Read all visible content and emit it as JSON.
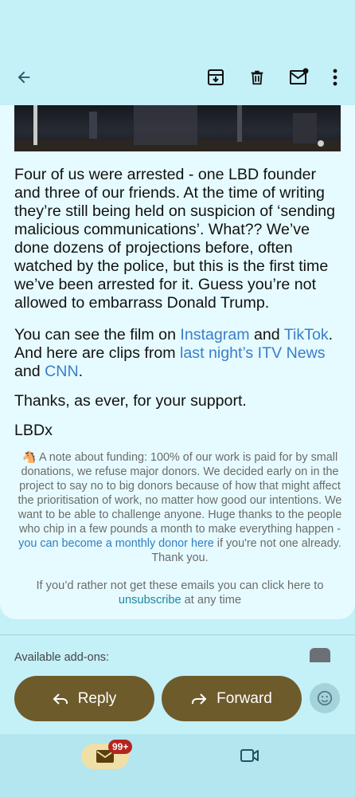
{
  "topbar": {
    "back_icon": "arrow-back-icon",
    "archive_icon": "archive-icon",
    "delete_icon": "trash-icon",
    "mark_unread_icon": "mark-unread-icon",
    "more_icon": "more-vert-icon"
  },
  "email": {
    "p1": "Four of us were arrested - one LBD founder and three of our friends. At the time of writing they’re still being held on suspicion of ‘sending malicious communications’. What?? We’ve done dozens of projections before, often watched by the police, but this is the first time we’ve been arrested for it. Guess you’re not allowed to embarrass Donald Trump.",
    "p2_a": "You can see the film on ",
    "p2_link1": "Instagram",
    "p2_b": " and ",
    "p2_link2": "TikTok",
    "p2_c": ". And here are clips from ",
    "p2_link3": "last night’s ITV News",
    "p2_d": " and ",
    "p2_link4": "CNN",
    "p2_e": ".",
    "p3": "Thanks, as ever, for your support.",
    "signature": "LBDx",
    "note_emoji": "🐴",
    "note_text": " A note about funding: 100% of our work is paid for by small donations, we refuse major donors. We decided early on in the project to say no to big donors because of how that might affect the prioritisation of work, no matter how good our intentions. We want to be able to challenge anyone. Huge thanks to the people who chip in a few pounds a month to make everything happen - ",
    "note_link": "you can become a monthly donor here",
    "note_after": " if you're not one already. Thank you.",
    "footer_before": "If you’d rather not get these emails you can click here to ",
    "footer_link": "unsubscribe",
    "footer_after": " at any time"
  },
  "addons": {
    "label": "Available add-ons:"
  },
  "actions": {
    "reply_label": "Reply",
    "forward_label": "Forward",
    "emoji_icon": "emoji-reaction-icon"
  },
  "bottom_nav": {
    "mail_icon": "mail-icon",
    "mail_badge": "99+",
    "meet_icon": "video-camera-icon"
  },
  "colors": {
    "background": "#c4f0f7",
    "card": "#e6fbff",
    "link": "#3a7dc9",
    "pill": "#6e5b2b",
    "badge": "#b3261e"
  }
}
